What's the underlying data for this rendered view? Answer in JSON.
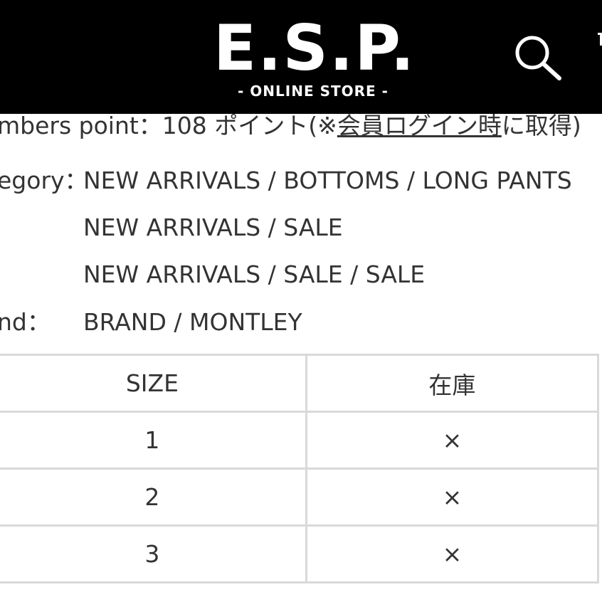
{
  "header": {
    "logo_main": "E.S.P.",
    "logo_sub": "- ONLINE STORE -",
    "icons": [
      "search-icon",
      "menu-icon"
    ],
    "colors": {
      "background": "#000000",
      "text": "#ffffff"
    }
  },
  "product_info": {
    "members_point_prefix": "mbers point：108 ポイント(※",
    "members_point_link": "会員ログイン時",
    "members_point_suffix": "に取得)",
    "category_label": "egory：",
    "category_values": [
      "NEW ARRIVALS / BOTTOMS / LONG PANTS",
      "NEW ARRIVALS / SALE",
      "NEW ARRIVALS / SALE / SALE"
    ],
    "brand_label": "nd：",
    "brand_value": "BRAND / MONTLEY"
  },
  "stock_table": {
    "headers": [
      "SIZE",
      "在庫"
    ],
    "rows": [
      {
        "size": "1",
        "stock": "×"
      },
      {
        "size": "2",
        "stock": "×"
      },
      {
        "size": "3",
        "stock": "×"
      }
    ]
  }
}
